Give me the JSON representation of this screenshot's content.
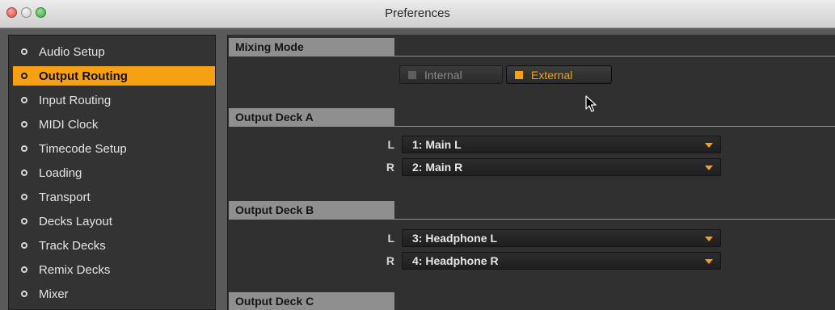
{
  "window": {
    "title": "Preferences"
  },
  "sidebar": {
    "items": [
      {
        "label": "Audio Setup",
        "active": false
      },
      {
        "label": "Output Routing",
        "active": true
      },
      {
        "label": "Input Routing",
        "active": false
      },
      {
        "label": "MIDI Clock",
        "active": false
      },
      {
        "label": "Timecode Setup",
        "active": false
      },
      {
        "label": "Loading",
        "active": false
      },
      {
        "label": "Transport",
        "active": false
      },
      {
        "label": "Decks Layout",
        "active": false
      },
      {
        "label": "Track Decks",
        "active": false
      },
      {
        "label": "Remix Decks",
        "active": false
      },
      {
        "label": "Mixer",
        "active": false
      }
    ]
  },
  "main": {
    "mixing_mode": {
      "header": "Mixing Mode",
      "options": [
        "Internal",
        "External"
      ],
      "selected": "External"
    },
    "deck_a": {
      "header": "Output Deck A",
      "left_letter": "L",
      "left_value": "1: Main L",
      "right_letter": "R",
      "right_value": "2: Main R"
    },
    "deck_b": {
      "header": "Output Deck B",
      "left_letter": "L",
      "left_value": "3: Headphone L",
      "right_letter": "R",
      "right_value": "4: Headphone R"
    },
    "deck_c": {
      "header": "Output Deck C"
    }
  },
  "colors": {
    "accent": "#f7a011",
    "panel_bg": "#303030",
    "header_tab": "#8f8f8f",
    "sidebar_bg": "#333333"
  }
}
